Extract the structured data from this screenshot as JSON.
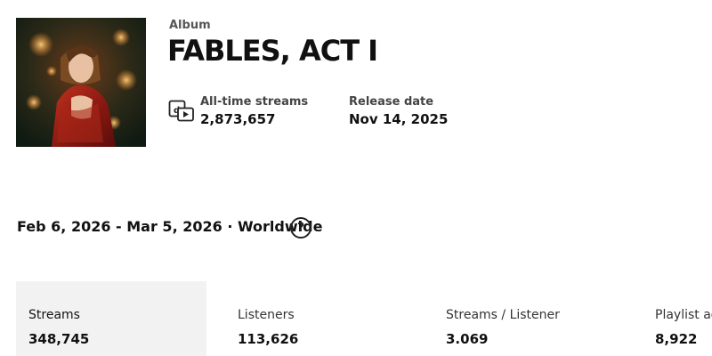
{
  "album": {
    "type_label": "Album",
    "title": "FABLES, ACT I",
    "cover_alt": "Album cover artwork: woman in red sequined shawl among glowing lights"
  },
  "stats": {
    "streams_icon": "streams-icon",
    "streams_label": "All-time streams",
    "streams_value": "2,873,657",
    "release_label": "Release date",
    "release_value": "Nov 14, 2025"
  },
  "filter": {
    "date_range": "Feb 6, 2026 - Mar 5, 2026 · Worldwide",
    "help_icon": "question-circle-icon",
    "help_glyph": "?"
  },
  "metrics": [
    {
      "label": "Streams",
      "value": "348,745",
      "selected": true
    },
    {
      "label": "Listeners",
      "value": "113,626",
      "selected": false
    },
    {
      "label": "Streams / Listener",
      "value": "3.069",
      "selected": false
    },
    {
      "label": "Playlist adds",
      "value": "8,922",
      "selected": false
    }
  ],
  "colors": {
    "text": "#111111",
    "muted": "#555555",
    "selected_card_bg": "#f2f2f2",
    "background": "#ffffff"
  }
}
